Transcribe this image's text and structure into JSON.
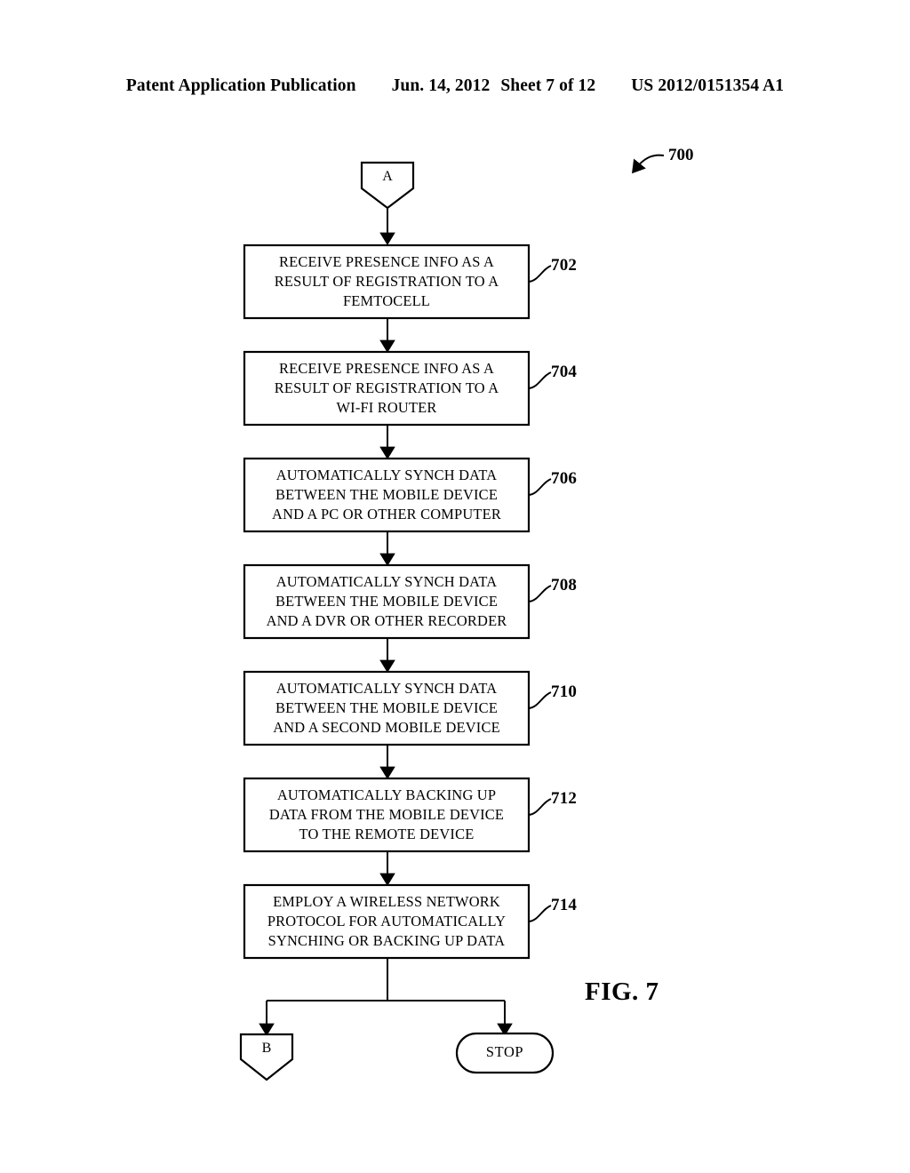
{
  "header": {
    "publication": "Patent Application Publication",
    "date": "Jun. 14, 2012",
    "sheet": "Sheet 7 of 12",
    "document_number": "US 2012/0151354 A1"
  },
  "figure": {
    "caption": "FIG. 7",
    "figure_reference": "700",
    "entry_connector": {
      "label": "A",
      "name": "connector-a"
    },
    "exit_connector": {
      "label": "B",
      "name": "connector-b"
    },
    "terminal": {
      "label": "STOP",
      "name": "terminal-stop"
    },
    "steps": [
      {
        "ref": "702",
        "lines": [
          "RECEIVE PRESENCE INFO AS A",
          "RESULT OF REGISTRATION TO A",
          "FEMTOCELL"
        ]
      },
      {
        "ref": "704",
        "lines": [
          "RECEIVE PRESENCE INFO AS A",
          "RESULT OF REGISTRATION TO A",
          "WI-FI ROUTER"
        ]
      },
      {
        "ref": "706",
        "lines": [
          "AUTOMATICALLY SYNCH DATA",
          "BETWEEN THE MOBILE DEVICE",
          "AND A PC OR OTHER COMPUTER"
        ]
      },
      {
        "ref": "708",
        "lines": [
          "AUTOMATICALLY SYNCH DATA",
          "BETWEEN THE MOBILE DEVICE",
          "AND A DVR OR OTHER RECORDER"
        ]
      },
      {
        "ref": "710",
        "lines": [
          "AUTOMATICALLY SYNCH DATA",
          "BETWEEN THE MOBILE DEVICE",
          "AND A SECOND MOBILE DEVICE"
        ]
      },
      {
        "ref": "712",
        "lines": [
          "AUTOMATICALLY BACKING UP",
          "DATA FROM THE MOBILE DEVICE",
          "TO THE REMOTE DEVICE"
        ]
      },
      {
        "ref": "714",
        "lines": [
          "EMPLOY A WIRELESS NETWORK",
          "PROTOCOL FOR AUTOMATICALLY",
          "SYNCHING OR BACKING UP DATA"
        ]
      }
    ]
  },
  "colors": {
    "ink": "#000000",
    "paper": "#ffffff"
  }
}
